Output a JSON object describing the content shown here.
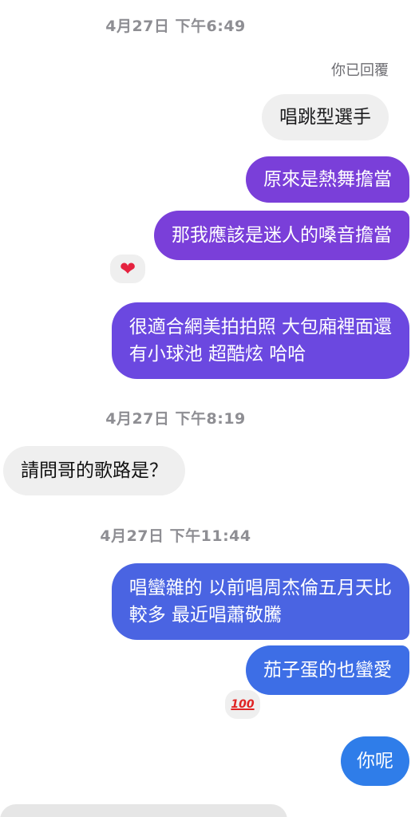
{
  "timestamps": {
    "t1": "4月27日 下午6:49",
    "t2": "4月27日 下午8:19",
    "t3": "4月27日 下午11:44"
  },
  "reply_note": "你已回覆",
  "messages": {
    "m1": "唱跳型選手",
    "m2": "原來是熱舞擔當",
    "m3": "那我應該是迷人的嗓音擔當",
    "m4_line1": "很適合網美拍拍照 大包廂裡面還",
    "m4_line2": "有小球池 超酷炫 哈哈",
    "m5": "請問哥的歌路是？",
    "m6_line1": "唱蠻雜的 以前唱周杰倫五月天比",
    "m6_line2": "較多 最近唱蕭敬騰",
    "m7": "茄子蛋的也蠻愛",
    "m8": "你呢"
  },
  "reactions": {
    "r1": "❤",
    "r2": "100"
  },
  "colors": {
    "purple": "#7a3fd9",
    "violet": "#6b48e0",
    "blue": "#2f7de9",
    "grey_bubble": "#efefef"
  }
}
